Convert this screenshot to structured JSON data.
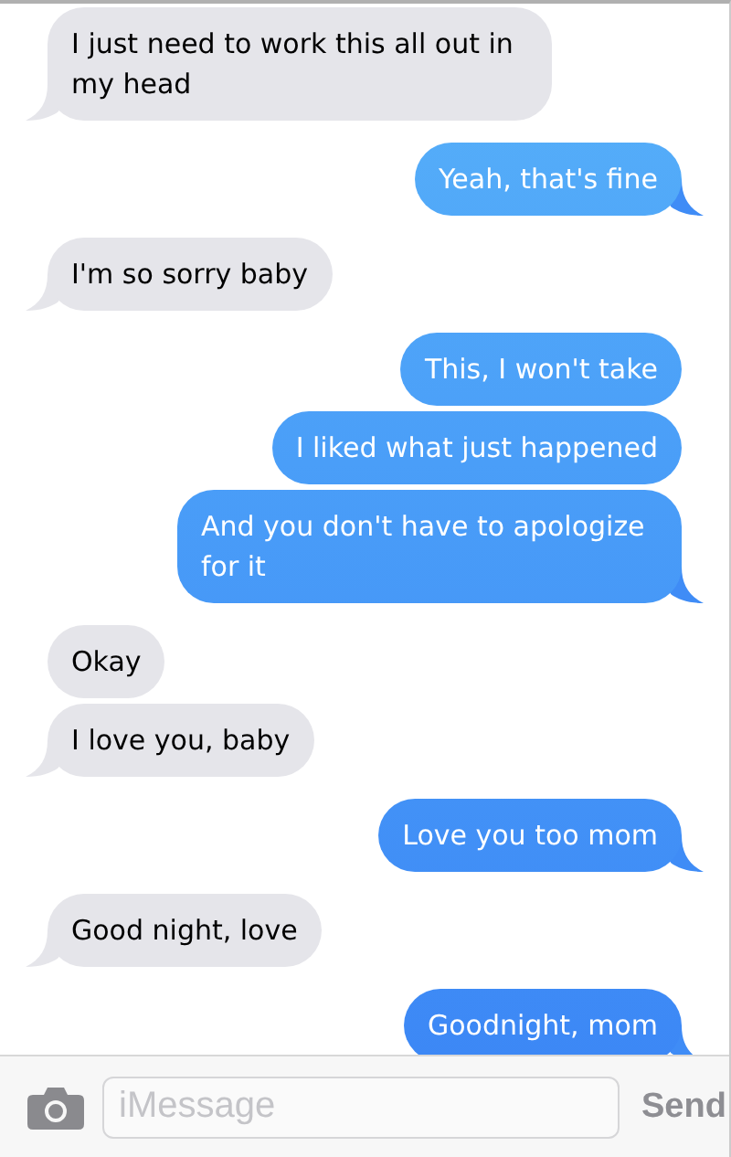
{
  "messages": [
    {
      "kind": "received",
      "text": "I just need to work this all out in my head",
      "tail": true
    },
    {
      "kind": "sent",
      "text": "Yeah, that's fine",
      "tail": true
    },
    {
      "kind": "received",
      "text": "I'm so sorry baby",
      "tail": true
    },
    {
      "kind": "sent",
      "text": "This, I won't take",
      "tail": false
    },
    {
      "kind": "sent",
      "text": "I liked what just happened",
      "tail": false
    },
    {
      "kind": "sent",
      "text": "And you don't have to apologize for it",
      "tail": true
    },
    {
      "kind": "received",
      "text": "Okay",
      "tail": false
    },
    {
      "kind": "received",
      "text": "I love you, baby",
      "tail": true
    },
    {
      "kind": "sent",
      "text": "Love you too mom",
      "tail": true
    },
    {
      "kind": "received",
      "text": "Good night, love",
      "tail": true
    },
    {
      "kind": "sent",
      "text": "Goodnight, mom",
      "tail": true
    }
  ],
  "input_bar": {
    "placeholder": "iMessage",
    "send_label": "Send"
  }
}
